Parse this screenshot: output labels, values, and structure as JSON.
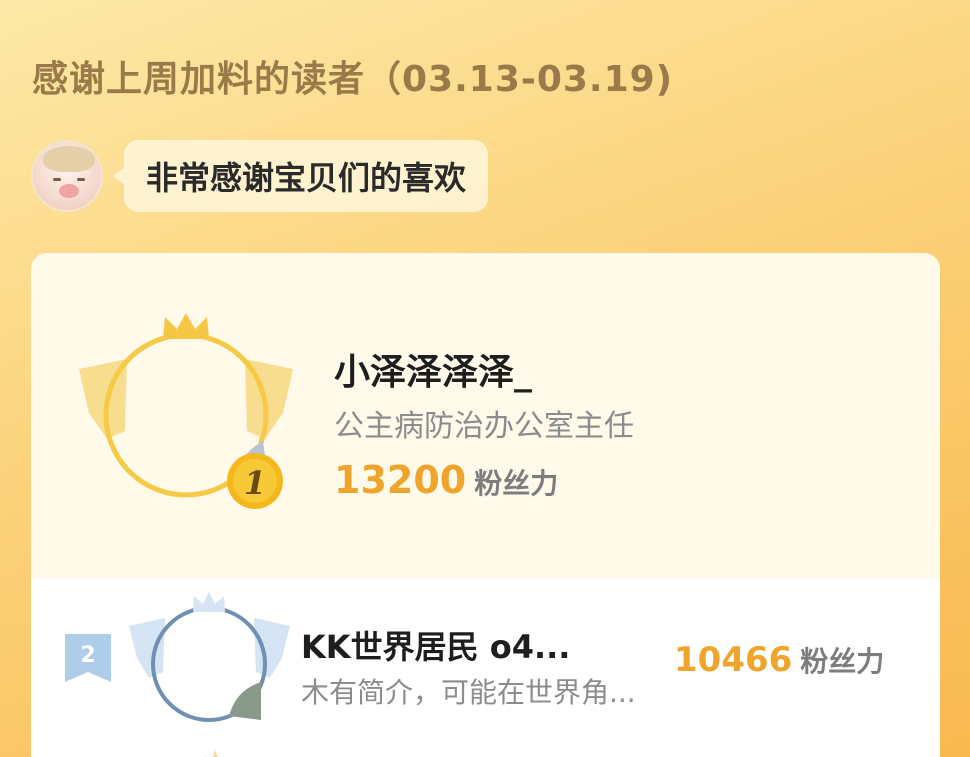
{
  "header": {
    "title": "感谢上周加料的读者（03.13-03.19)"
  },
  "message": {
    "text": "非常感谢宝贝们的喜欢"
  },
  "leaderboard": {
    "first": {
      "rank": "1",
      "name": "小泽泽泽泽_",
      "bio": "公主病防治办公室主任",
      "score": "13200",
      "unit": "粉丝力"
    },
    "second": {
      "rank": "2",
      "name": "KK世界居民  o4...",
      "bio": "木有简介，可能在世界角...",
      "score": "10466",
      "unit": "粉丝力"
    }
  },
  "colors": {
    "gold": "#efa42c",
    "silver": "#8fb6d9",
    "title": "#9a7a48"
  },
  "icons": {
    "first_badge": "gold-crown-wings-badge-icon",
    "second_badge": "silver-crown-wings-badge-icon",
    "rank2": "rank-ribbon-icon"
  }
}
